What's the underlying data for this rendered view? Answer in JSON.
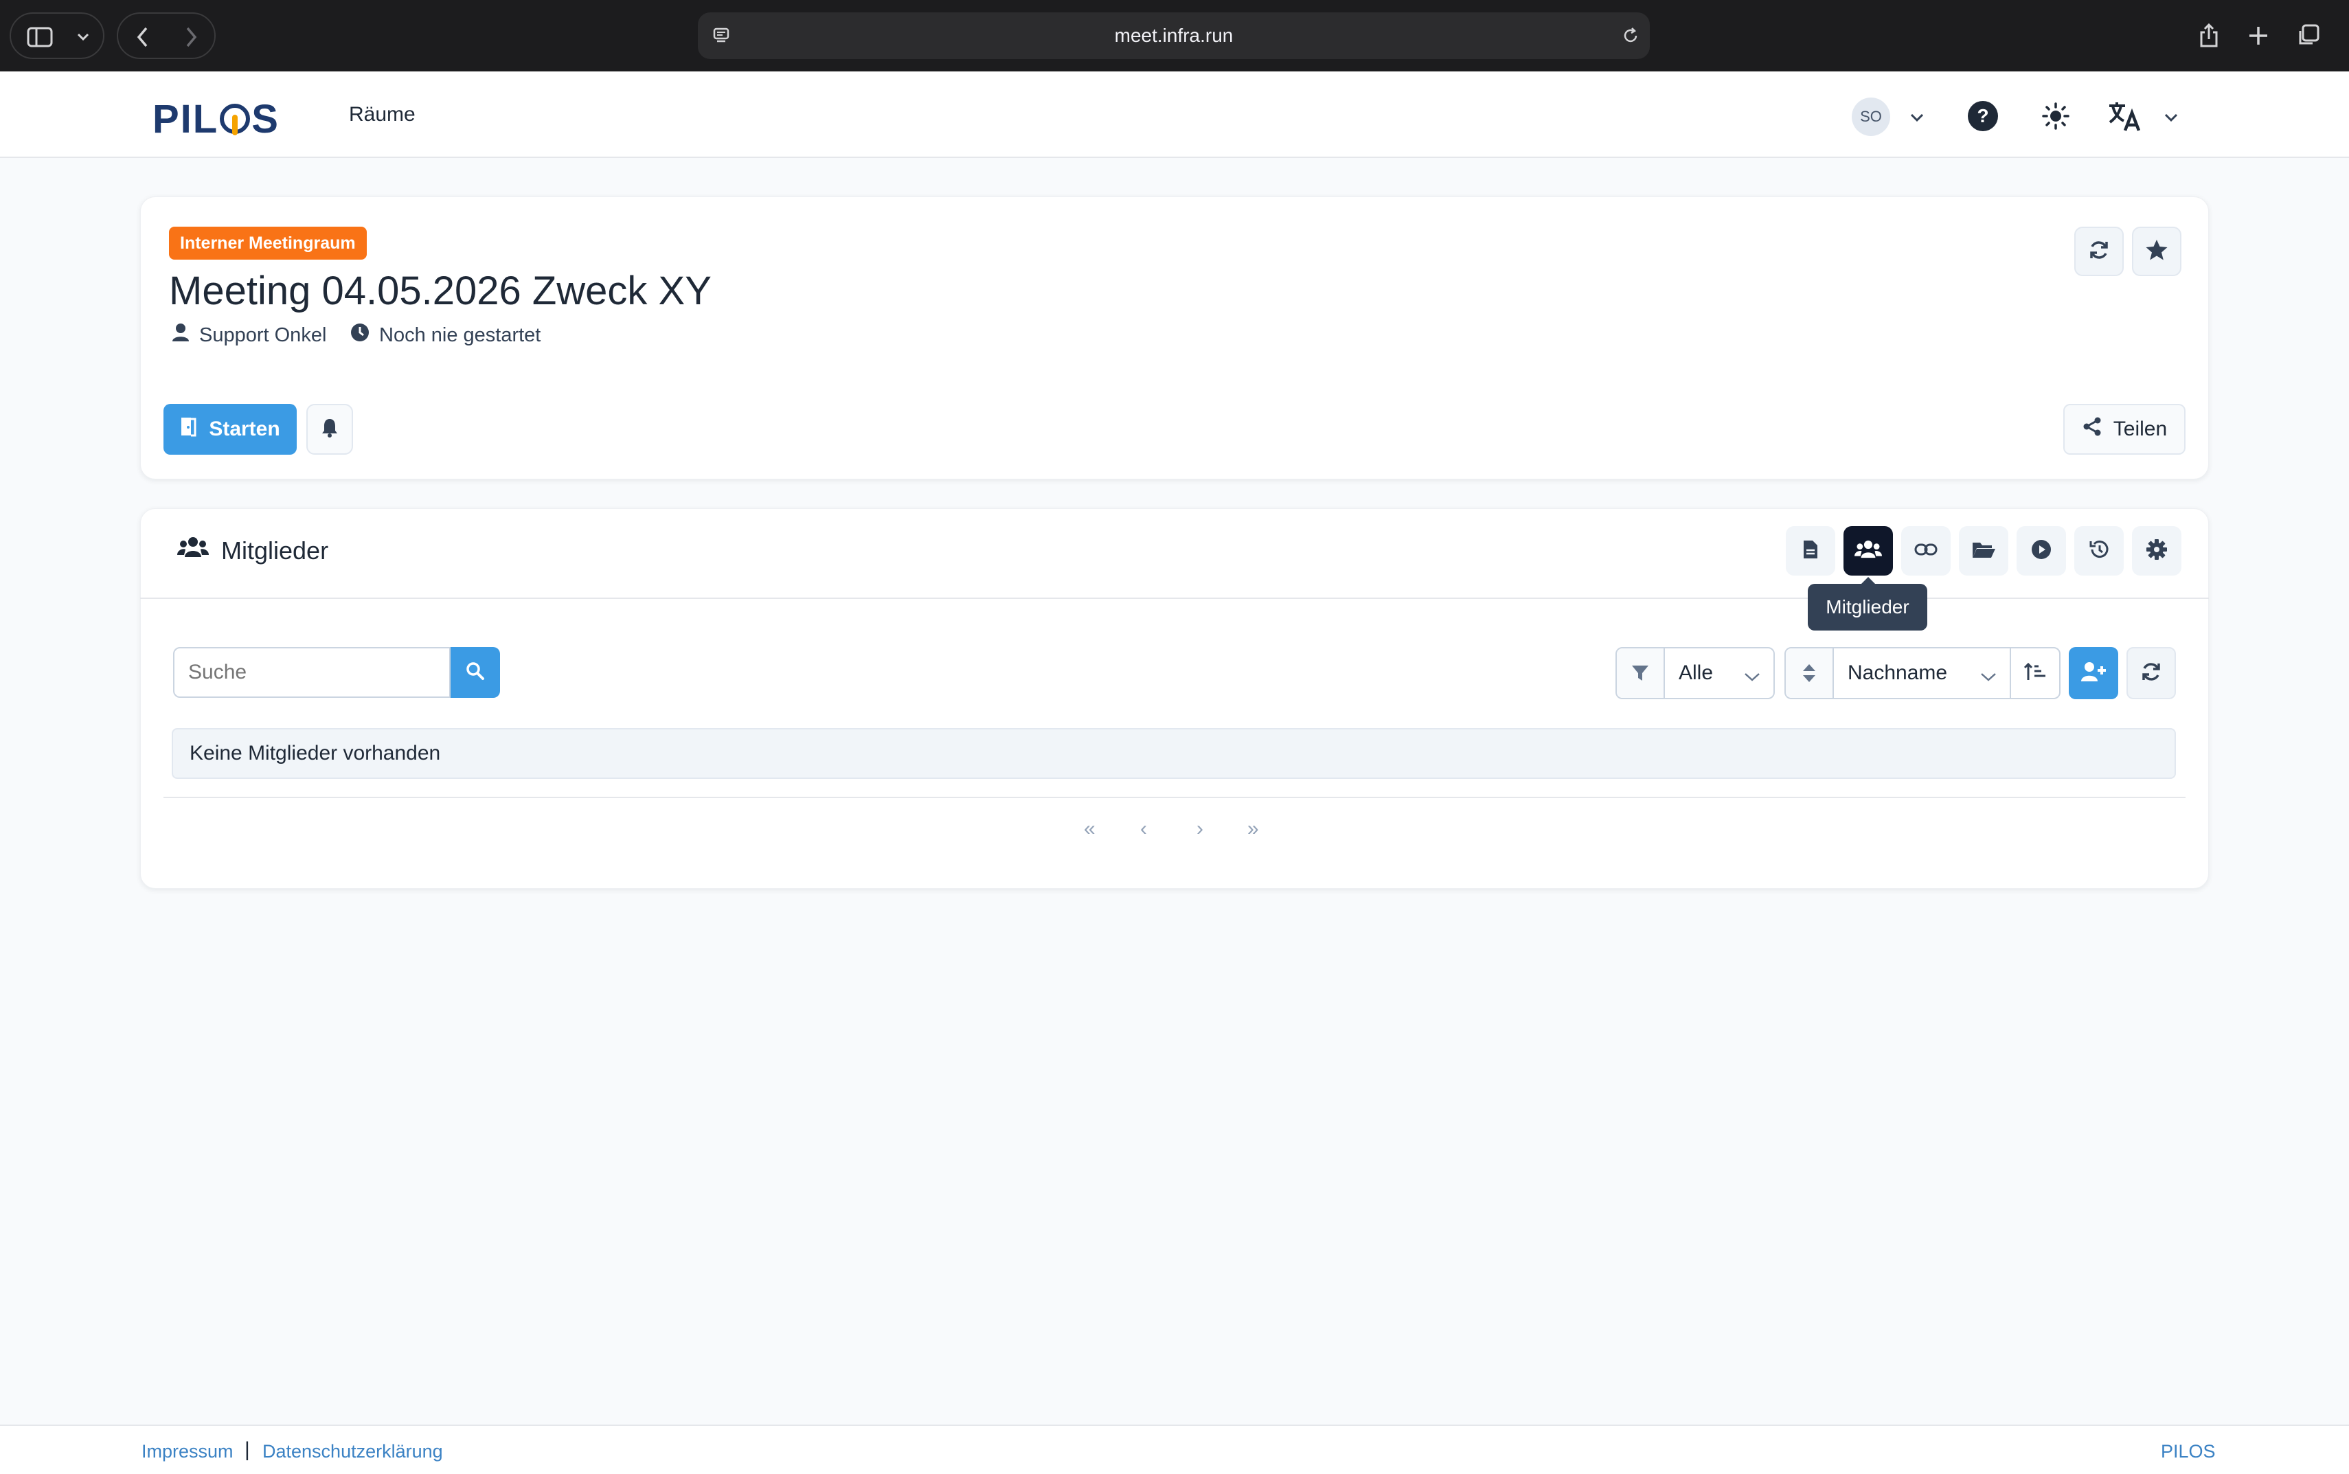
{
  "browser": {
    "url": "meet.infra.run"
  },
  "header": {
    "logo_text": "PILOS",
    "nav_rooms": "Räume",
    "user_initials": "SO"
  },
  "room": {
    "badge": "Interner Meetingraum",
    "title": "Meeting 04.05.2026 Zweck XY",
    "owner": "Support Onkel",
    "status": "Noch nie gestartet",
    "start_label": "Starten",
    "share_label": "Teilen"
  },
  "members": {
    "section_title": "Mitglieder",
    "tooltip": "Mitglieder",
    "search_placeholder": "Suche",
    "filter_value": "Alle",
    "sort_value": "Nachname",
    "empty_message": "Keine Mitglieder vorhanden",
    "pager": {
      "first": "«",
      "prev": "‹",
      "next": "›",
      "last": "»"
    }
  },
  "footer": {
    "imprint": "Impressum",
    "separator": "|",
    "privacy": "Datenschutzerklärung",
    "brand": "PILOS"
  },
  "colors": {
    "accent": "#3b9be4",
    "badge": "#f97316",
    "active_tab": "#0f172a"
  }
}
